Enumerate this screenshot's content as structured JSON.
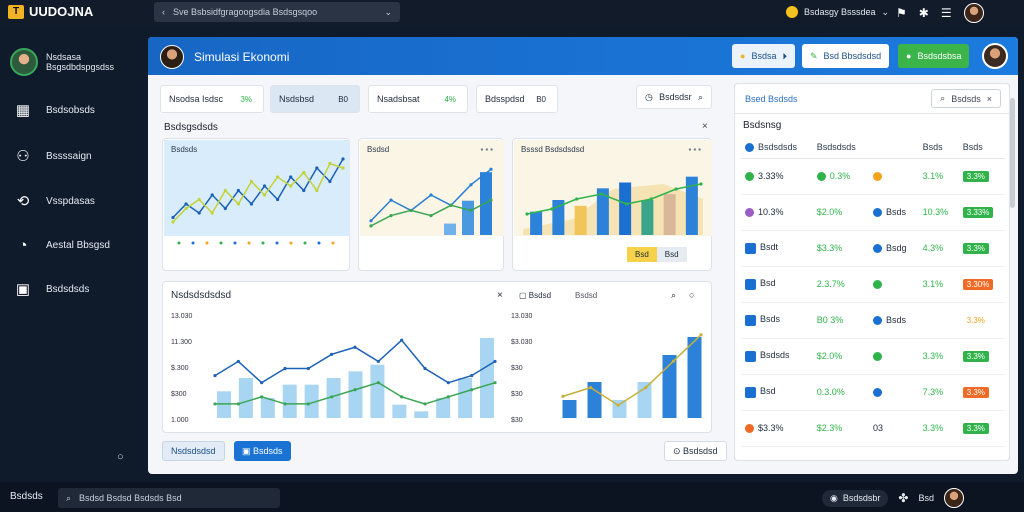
{
  "app": {
    "name": "UUDOJNA",
    "url_text": "Sve Bsbsidfgragoogsdia Bsdsgsqoo",
    "user_text": "Bsdasgy Bsssdea"
  },
  "sidebar": {
    "profile_name": "Nsdsasa",
    "profile_sub": "Bsgsdbdspgsdss",
    "items": [
      {
        "label": "Bsdsobsds",
        "icon": "grid-icon"
      },
      {
        "label": "Bssssaign",
        "icon": "people-icon"
      },
      {
        "label": "Vsspdasas",
        "icon": "network-icon"
      },
      {
        "label": "Aestal Bbsgsd",
        "icon": "gauge-icon"
      },
      {
        "label": "Bsdsdsds",
        "icon": "briefcase-icon"
      }
    ]
  },
  "main": {
    "title": "Simulasi Ekonomi",
    "header_buttons": [
      "Bsdsa",
      "Bsd Bbsdsdsd",
      "Bsdsdsbsa"
    ],
    "tabs": [
      {
        "label": "Nsodsa Isdsc",
        "chip": "3%"
      },
      {
        "label": "Nsdsbsd",
        "chip": "B0"
      },
      {
        "label": "Nsadsbsat",
        "chip": "4%"
      },
      {
        "label": "Bdsspdsd",
        "chip": "B0"
      }
    ],
    "filter_label": "Bsdsdsr",
    "section_title": "Bsdsgsdsds",
    "mini_labels": [
      "Bsdsds",
      "Bsdsd",
      "Bsssd Bsdsdsdsd"
    ],
    "toggle": [
      "Bsd",
      "Bsd"
    ],
    "chart_section_title": "Nsdsdsdsdsd",
    "chart_section_tabs": [
      "Bsdsd",
      "Bsdsd"
    ],
    "bottom_buttons": [
      "Nsdsdsdsd",
      "Bsdsds",
      "Bsdsdsd"
    ]
  },
  "right": {
    "top_label": "Bsed Bsdsds",
    "search_label": "Bsdsds",
    "title": "Bsdsnsg",
    "columns": [
      "Bsdsdsds",
      "Bsdsdsds",
      "Bsds",
      "Bsds"
    ],
    "rows": [
      {
        "c1": "3.33%",
        "c2": "0.3%",
        "c3": "",
        "c4": "3.1%",
        "c5": "3.3%",
        "dot1": "#2fb34a",
        "dot2": "#2fb34a",
        "dot3": "#f2a31b",
        "b": "#2fb34a"
      },
      {
        "c1": "10.3%",
        "c2": "$2.0%",
        "c3": "Bsds",
        "c4": "10.3%",
        "c5": "3.33%",
        "dot1": "#9b5ec4",
        "dot2": "",
        "dot3": "#1a6fd1",
        "b": "#2fb34a"
      },
      {
        "c1": "Bsdt",
        "c2": "$3.3%",
        "c3": "Bsdg",
        "c4": "4.3%",
        "c5": "3.3%",
        "dot1": "",
        "dot2": "",
        "dot3": "#1a6fd1",
        "b": "#2fb34a"
      },
      {
        "c1": "Bsd",
        "c2": "2.3.7%",
        "c3": "",
        "c4": "3.1%",
        "c5": "3.30%",
        "dot1": "",
        "dot2": "",
        "dot3": "#2fb34a",
        "b": "#ef6a24"
      },
      {
        "c1": "Bsds",
        "c2": "B0 3%",
        "c3": "Bsds",
        "c4": "",
        "c5": "3.3%",
        "dot1": "",
        "dot2": "",
        "dot3": "#1a6fd1",
        "b": ""
      },
      {
        "c1": "Bsdsds",
        "c2": "$2.0%",
        "c3": "",
        "c4": "3.3%",
        "c5": "3.3%",
        "dot1": "",
        "dot2": "",
        "dot3": "#2fb34a",
        "b": "#2fb34a"
      },
      {
        "c1": "Bsd",
        "c2": "0.3.0%",
        "c3": "",
        "c4": "7.3%",
        "c5": "3.3%",
        "dot1": "",
        "dot2": "",
        "dot3": "#1a6fd1",
        "b": "#ef6a24"
      },
      {
        "c1": "$3.3%",
        "c2": "$2.3%",
        "c3": "03",
        "c4": "3.3%",
        "c5": "3.3%",
        "dot1": "#ef6a24",
        "dot2": "",
        "dot3": "",
        "b": "#2fb34a"
      }
    ]
  },
  "statusbar": {
    "left": "Bsdsds",
    "search": "Bsdsd Bsdsd Bsdsds Bsd",
    "right_pill": "Bsdsdsbr",
    "right_label": "Bsd"
  },
  "chart_data": [
    {
      "type": "line",
      "series": [
        {
          "values": [
            3,
            6,
            4,
            8,
            5,
            9,
            6,
            10,
            7,
            12,
            9,
            14,
            11,
            16
          ]
        }
      ],
      "xlabel": "",
      "ylabel": ""
    },
    {
      "type": "bar",
      "series": [
        {
          "values": [
            3,
            2,
            4,
            3,
            5,
            9,
            14
          ]
        },
        {
          "values": [
            2,
            5,
            3,
            6,
            4,
            8,
            10
          ]
        }
      ]
    },
    {
      "type": "bar",
      "series": [
        {
          "values": [
            4,
            6,
            5,
            8,
            9,
            6,
            7,
            10
          ]
        }
      ]
    },
    {
      "type": "bar",
      "y_ticks": [
        "13.030",
        "11.300",
        "$.300",
        "$300",
        "1.000"
      ],
      "series": [
        {
          "values": [
            4,
            6,
            3,
            5,
            5,
            6,
            7,
            8,
            2,
            1,
            3,
            6,
            12
          ]
        },
        {
          "values": [
            5,
            7,
            4,
            5,
            8,
            6,
            10,
            3,
            6,
            4,
            5,
            9,
            4
          ]
        }
      ]
    },
    {
      "type": "bar",
      "y_ticks": [
        "13.030",
        "$3.030",
        "$30",
        "$30",
        "$30"
      ],
      "series": [
        {
          "values": [
            2,
            4,
            2,
            4,
            7,
            9
          ]
        }
      ]
    }
  ]
}
